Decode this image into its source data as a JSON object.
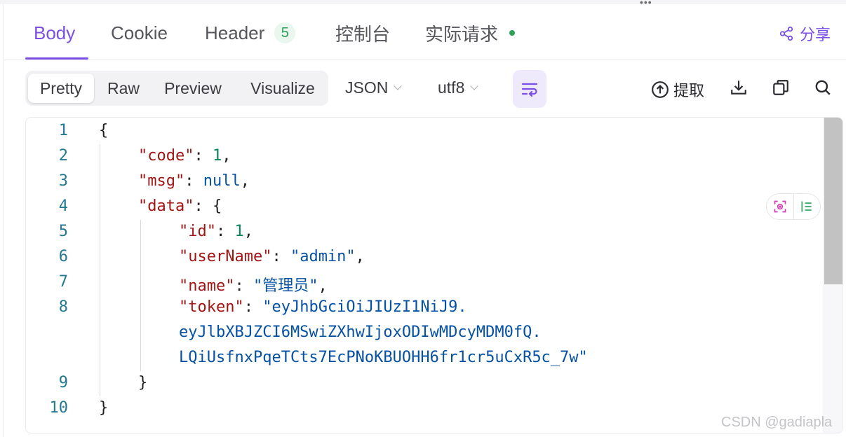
{
  "tabs": {
    "body": "Body",
    "cookie": "Cookie",
    "header": "Header",
    "header_count": "5",
    "console": "控制台",
    "actual_request": "实际请求",
    "share": "分享"
  },
  "view_modes": [
    "Pretty",
    "Raw",
    "Preview",
    "Visualize"
  ],
  "active_view_mode": "Pretty",
  "format_select": "JSON",
  "encoding_select": "utf8",
  "toolbar": {
    "extract": "提取"
  },
  "colors": {
    "accent": "#7b4fe6",
    "status_green": "#2ea05a",
    "json_key": "#a31515",
    "json_string": "#0451a5",
    "json_number": "#098658"
  },
  "code": {
    "line_numbers": [
      "1",
      "2",
      "3",
      "4",
      "5",
      "6",
      "7",
      "8",
      "9",
      "10"
    ],
    "open_brace": "{",
    "close_brace": "}",
    "code_key": "\"code\"",
    "code_value": "1",
    "msg_key": "\"msg\"",
    "msg_value": "null",
    "data_key": "\"data\"",
    "id_key": "\"id\"",
    "id_value": "1",
    "username_key": "\"userName\"",
    "username_value": "\"admin\"",
    "name_key": "\"name\"",
    "name_value": "\"管理员\"",
    "token_key": "\"token\"",
    "token_line1": "\"eyJhbGciOiJIUzI1NiJ9.",
    "token_line2": "eyJlbXBJZCI6MSwiZXhwIjoxODIwMDcyMDM0fQ.",
    "token_line3": "LQiUsfnxPqeTCts7EcPNoKBUOHH6fr1cr5uCxR5c_7w\""
  },
  "watermark": "CSDN @gadiapla"
}
